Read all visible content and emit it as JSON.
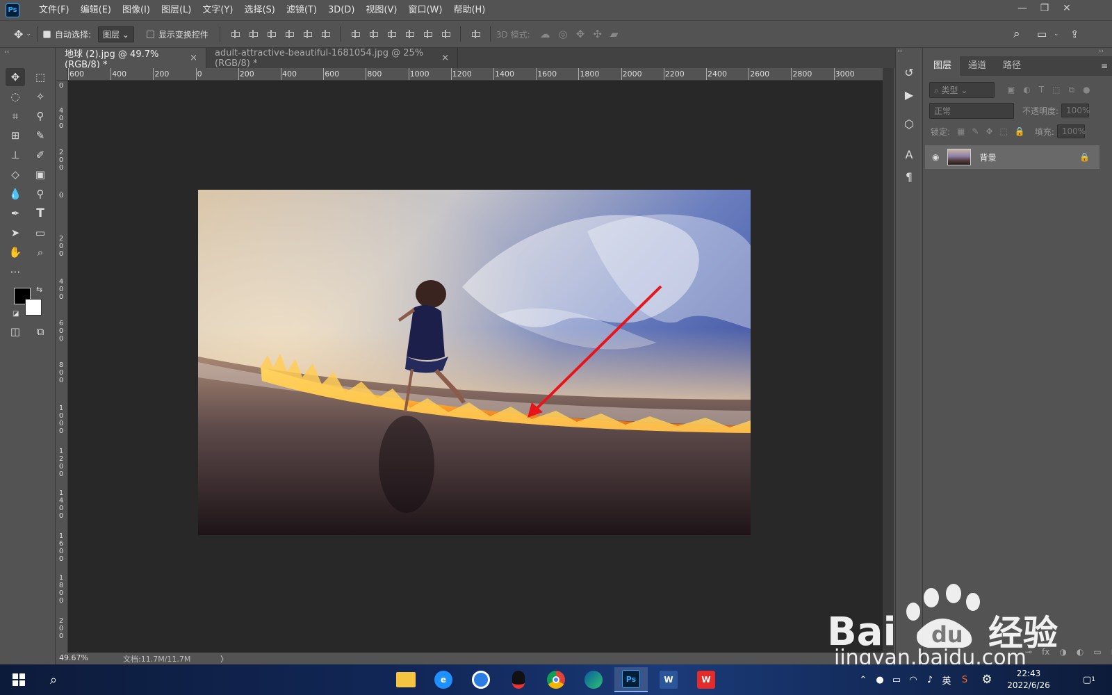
{
  "app": {
    "logo": "Ps"
  },
  "menu": [
    "文件(F)",
    "编辑(E)",
    "图像(I)",
    "图层(L)",
    "文字(Y)",
    "选择(S)",
    "滤镜(T)",
    "3D(D)",
    "视图(V)",
    "窗口(W)",
    "帮助(H)"
  ],
  "options": {
    "auto_select_label": "自动选择:",
    "auto_select_value": "图层",
    "show_transform_label": "显示变换控件",
    "mode_3d_label": "3D 模式:"
  },
  "tabs": [
    {
      "label": "地球 (2).jpg @ 49.7%(RGB/8) *",
      "close": "×"
    },
    {
      "label": "adult-attractive-beautiful-1681054.jpg @ 25%(RGB/8) *",
      "close": "×"
    }
  ],
  "ruler_top": [
    "600",
    "400",
    "200",
    "0",
    "200",
    "400",
    "600",
    "800",
    "1000",
    "1200",
    "1400",
    "1600",
    "1800",
    "2000",
    "2200",
    "2400",
    "2600",
    "2800",
    "3000"
  ],
  "ruler_left": [
    "0",
    "4\n0\n0",
    "2\n0\n0",
    "0",
    "2\n0\n0",
    "4\n0\n0",
    "6\n0\n0",
    "8\n0\n0",
    "1\n0\n0\n0",
    "1\n2\n0\n0",
    "1\n4\n0\n0",
    "1\n6\n0\n0",
    "1\n8\n0\n0",
    "2\n0\n0"
  ],
  "status": {
    "zoom": "49.67%",
    "doc": "文档:11.7M/11.7M",
    "arrow": "〉"
  },
  "panel": {
    "tabs": [
      "图层",
      "通道",
      "路径"
    ],
    "kind_placeholder": "类型",
    "blend_mode": "正常",
    "opacity_label": "不透明度:",
    "opacity_value": "100%",
    "lock_label": "锁定:",
    "fill_label": "填充:",
    "fill_value": "100%",
    "layer_name": "背景"
  },
  "taskbar": {
    "time": "22:43",
    "date": "2022/6/26",
    "ime": "英",
    "notif": "1"
  },
  "watermark": {
    "text": "Bai du 经验",
    "url": "jingyan.baidu.com"
  },
  "colors": {
    "accent": "#31a8ff",
    "arrow": "#e8141a"
  }
}
